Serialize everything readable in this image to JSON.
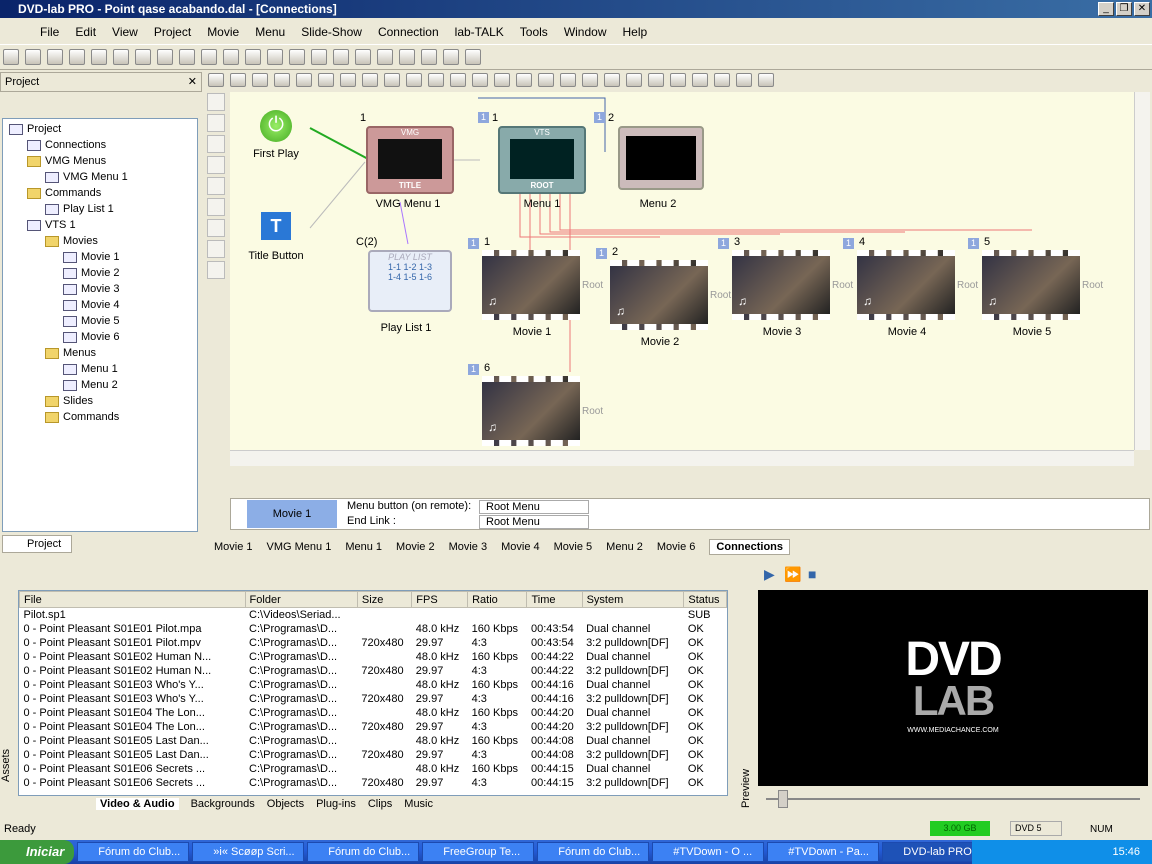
{
  "window": {
    "title": "DVD-lab PRO - Point qase acabando.dal - [Connections]"
  },
  "menu": [
    "File",
    "Edit",
    "View",
    "Project",
    "Movie",
    "Menu",
    "Slide-Show",
    "Connection",
    "lab-TALK",
    "Tools",
    "Window",
    "Help"
  ],
  "project_panel": {
    "title": "Project",
    "tab": "Project",
    "tree": [
      {
        "label": "Project",
        "level": 0
      },
      {
        "label": "Connections",
        "level": 1
      },
      {
        "label": "VMG Menus",
        "level": 1
      },
      {
        "label": "VMG Menu 1",
        "level": 2
      },
      {
        "label": "Commands",
        "level": 1
      },
      {
        "label": "Play List 1",
        "level": 2
      },
      {
        "label": "VTS 1",
        "level": 1
      },
      {
        "label": "Movies",
        "level": 2
      },
      {
        "label": "Movie 1",
        "level": 3
      },
      {
        "label": "Movie 2",
        "level": 3
      },
      {
        "label": "Movie 3",
        "level": 3
      },
      {
        "label": "Movie 4",
        "level": 3
      },
      {
        "label": "Movie 5",
        "level": 3
      },
      {
        "label": "Movie 6",
        "level": 3
      },
      {
        "label": "Menus",
        "level": 2
      },
      {
        "label": "Menu 1",
        "level": 3
      },
      {
        "label": "Menu 2",
        "level": 3
      },
      {
        "label": "Slides",
        "level": 2
      },
      {
        "label": "Commands",
        "level": 2
      }
    ]
  },
  "canvas": {
    "first_play": "First Play",
    "title_button": "Title Button",
    "vmg_menu": "VMG Menu 1",
    "vmg_num": "1",
    "menu1": "Menu 1",
    "menu2": "Menu 2",
    "menu1_num": "1",
    "menu2_num": "2",
    "playlist": "Play List 1",
    "playlist_tag": "C(2)",
    "movies": [
      "Movie 1",
      "Movie 2",
      "Movie 3",
      "Movie 4",
      "Movie 5",
      "Movie 6"
    ],
    "movie_nums": [
      "1",
      "2",
      "3",
      "4",
      "5",
      "6"
    ],
    "root": "Root",
    "vmg_label": "VMG",
    "title_label": "TITLE",
    "vts_label": "VTS",
    "root_label": "ROOT",
    "playlist_label": "PLAY LIST",
    "playlist_items": [
      "1-1 1-2 1-3",
      "1-4 1-5 1-6"
    ]
  },
  "props": {
    "selected": "Movie 1",
    "menu_button_label": "Menu button (on remote):",
    "menu_button_value": "Root Menu",
    "end_link_label": "End Link :",
    "end_link_value": "Root Menu"
  },
  "doc_tabs": [
    "Movie 1",
    "VMG Menu 1",
    "Menu 1",
    "Movie 2",
    "Movie 3",
    "Movie 4",
    "Movie 5",
    "Menu 2",
    "Movie 6",
    "Connections"
  ],
  "assets": {
    "side_label": "Assets",
    "columns": [
      "File",
      "Folder",
      "Size",
      "FPS",
      "Ratio",
      "Time",
      "System",
      "Status"
    ],
    "rows": [
      [
        "Pilot.sp1",
        "C:\\Videos\\Seriad...",
        "",
        "",
        "",
        "",
        "",
        "SUB"
      ],
      [
        "0 - Point Pleasant S01E01 Pilot.mpa",
        "C:\\Programas\\D...",
        "",
        "48.0 kHz",
        "160 Kbps",
        "00:43:54",
        "Dual channel",
        "OK"
      ],
      [
        "0 - Point Pleasant S01E01 Pilot.mpv",
        "C:\\Programas\\D...",
        "720x480",
        "29.97",
        "4:3",
        "00:43:54",
        "3:2 pulldown[DF]",
        "OK"
      ],
      [
        "0 - Point Pleasant S01E02 Human N...",
        "C:\\Programas\\D...",
        "",
        "48.0 kHz",
        "160 Kbps",
        "00:44:22",
        "Dual channel",
        "OK"
      ],
      [
        "0 - Point Pleasant S01E02 Human N...",
        "C:\\Programas\\D...",
        "720x480",
        "29.97",
        "4:3",
        "00:44:22",
        "3:2 pulldown[DF]",
        "OK"
      ],
      [
        "0 - Point Pleasant S01E03 Who's Y...",
        "C:\\Programas\\D...",
        "",
        "48.0 kHz",
        "160 Kbps",
        "00:44:16",
        "Dual channel",
        "OK"
      ],
      [
        "0 - Point Pleasant S01E03 Who's Y...",
        "C:\\Programas\\D...",
        "720x480",
        "29.97",
        "4:3",
        "00:44:16",
        "3:2 pulldown[DF]",
        "OK"
      ],
      [
        "0 - Point Pleasant S01E04 The Lon...",
        "C:\\Programas\\D...",
        "",
        "48.0 kHz",
        "160 Kbps",
        "00:44:20",
        "Dual channel",
        "OK"
      ],
      [
        "0 - Point Pleasant S01E04 The Lon...",
        "C:\\Programas\\D...",
        "720x480",
        "29.97",
        "4:3",
        "00:44:20",
        "3:2 pulldown[DF]",
        "OK"
      ],
      [
        "0 - Point Pleasant S01E05 Last Dan...",
        "C:\\Programas\\D...",
        "",
        "48.0 kHz",
        "160 Kbps",
        "00:44:08",
        "Dual channel",
        "OK"
      ],
      [
        "0 - Point Pleasant S01E05 Last Dan...",
        "C:\\Programas\\D...",
        "720x480",
        "29.97",
        "4:3",
        "00:44:08",
        "3:2 pulldown[DF]",
        "OK"
      ],
      [
        "0 - Point Pleasant S01E06 Secrets ...",
        "C:\\Programas\\D...",
        "",
        "48.0 kHz",
        "160 Kbps",
        "00:44:15",
        "Dual channel",
        "OK"
      ],
      [
        "0 - Point Pleasant S01E06 Secrets ...",
        "C:\\Programas\\D...",
        "720x480",
        "29.97",
        "4:3",
        "00:44:15",
        "3:2 pulldown[DF]",
        "OK"
      ]
    ],
    "tabs": [
      "Video & Audio",
      "Backgrounds",
      "Objects",
      "Plug-ins",
      "Clips",
      "Music"
    ]
  },
  "preview": {
    "side_label": "Preview",
    "logo_top": "DVD",
    "logo_bottom": "LAB",
    "url": "WWW.MEDIACHANCE.COM"
  },
  "status": {
    "ready": "Ready",
    "disk": "3.00 GB",
    "media": "DVD 5",
    "num": "NUM"
  },
  "taskbar": {
    "start": "Iniciar",
    "items": [
      "Fórum do Club...",
      "»i« Scøøp Scri...",
      "Fórum do Club...",
      "FreeGroup Te...",
      "Fórum do Club...",
      "#TVDown - O ...",
      "#TVDown - Pa...",
      "DVD-lab PRO ..."
    ],
    "clock": "15:46"
  }
}
